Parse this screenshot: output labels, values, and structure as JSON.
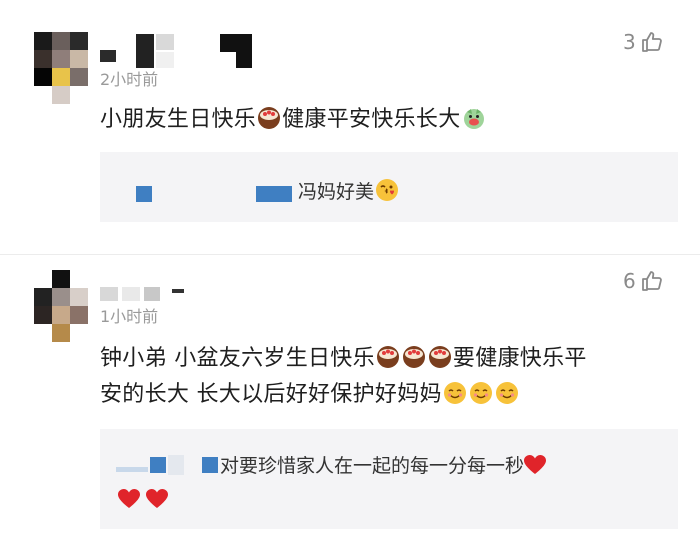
{
  "comments": [
    {
      "time": "2小时前",
      "likes": "3",
      "text_before_cake": "小朋友生日快乐",
      "text_after_cake": "健康平安快乐长大",
      "reply": {
        "text": "冯妈好美"
      },
      "icons": [
        "birthday-cake-emoji",
        "dragon-emoji",
        "kissing-heart-emoji"
      ]
    },
    {
      "time": "1小时前",
      "likes": "6",
      "line1_a": "钟小弟 小盆友六岁生日快乐",
      "line1_b": "要健康快乐平",
      "line2": "安的长大 长大以后好好保护好妈妈",
      "reply": {
        "text": "对要珍惜家人在一起的每一分每一秒"
      },
      "icons": [
        "birthday-cake-emoji",
        "smiling-emoji",
        "red-heart-emoji"
      ]
    }
  ],
  "colors": {
    "text": "#1f1f1f",
    "meta": "#9a9a9a",
    "reply_bg": "#f4f4f6",
    "mask_blue": "#3f7fc2",
    "heart": "#e0242a"
  }
}
